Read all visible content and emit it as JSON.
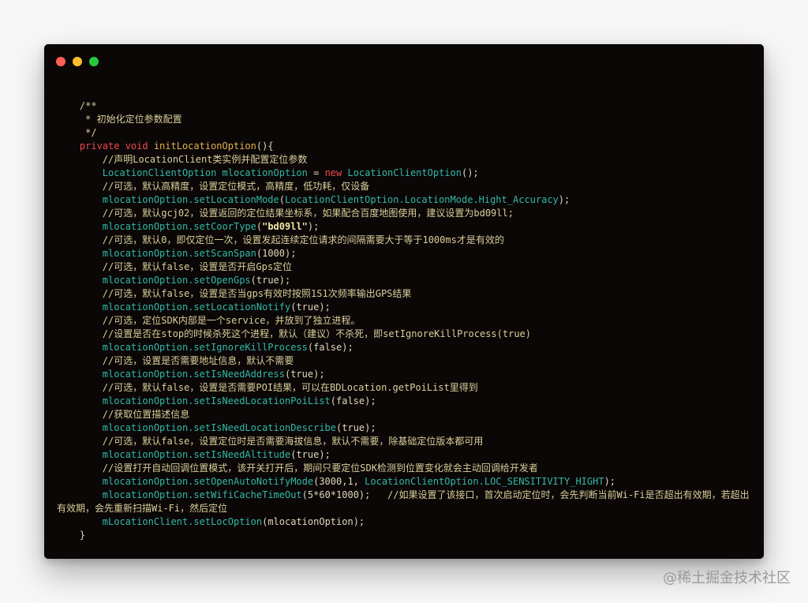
{
  "window": {
    "controls": {
      "close": "close",
      "minimize": "minimize",
      "zoom": "zoom"
    }
  },
  "code": {
    "lines": [
      {
        "segs": [
          {
            "t": "    "
          },
          {
            "c": "cm",
            "t": "/**"
          }
        ]
      },
      {
        "segs": [
          {
            "t": "     "
          },
          {
            "c": "cm",
            "t": "* 初始化定位参数配置"
          }
        ]
      },
      {
        "segs": [
          {
            "t": "     "
          },
          {
            "c": "cm",
            "t": "*/"
          }
        ]
      },
      {
        "segs": [
          {
            "t": "    "
          },
          {
            "c": "kw",
            "t": "private void "
          },
          {
            "c": "fn",
            "t": "initLocationOption"
          },
          {
            "c": "pn",
            "t": "(){"
          }
        ]
      },
      {
        "segs": [
          {
            "t": "        "
          },
          {
            "c": "cm",
            "t": "//声明LocationClient类实例并配置定位参数"
          }
        ]
      },
      {
        "segs": [
          {
            "t": "        "
          },
          {
            "c": "cls",
            "t": "LocationClientOption mlocationOption "
          },
          {
            "c": "pn",
            "t": "= "
          },
          {
            "c": "kw",
            "t": "new "
          },
          {
            "c": "cls",
            "t": "LocationClientOption"
          },
          {
            "c": "pn",
            "t": "();"
          }
        ]
      },
      {
        "segs": [
          {
            "t": "        "
          },
          {
            "c": "cm",
            "t": "//可选，默认高精度，设置定位模式，高精度，低功耗，仅设备"
          }
        ]
      },
      {
        "segs": [
          {
            "t": "        "
          },
          {
            "c": "cls",
            "t": "mlocationOption.setLocationMode"
          },
          {
            "c": "pn",
            "t": "("
          },
          {
            "c": "cls",
            "t": "LocationClientOption.LocationMode.Hight_Accuracy"
          },
          {
            "c": "pn",
            "t": ");"
          }
        ]
      },
      {
        "segs": [
          {
            "t": "        "
          },
          {
            "c": "cm",
            "t": "//可选，默认gcj02，设置返回的定位结果坐标系，如果配合百度地图使用，建议设置为bd09ll;"
          }
        ]
      },
      {
        "segs": [
          {
            "t": "        "
          },
          {
            "c": "cls",
            "t": "mlocationOption.setCoorType"
          },
          {
            "c": "pn",
            "t": "("
          },
          {
            "c": "str",
            "t": "\"bd09ll\""
          },
          {
            "c": "pn",
            "t": ");"
          }
        ]
      },
      {
        "segs": [
          {
            "t": "        "
          },
          {
            "c": "cm",
            "t": "//可选，默认0，即仅定位一次，设置发起连续定位请求的间隔需要大于等于1000ms才是有效的"
          }
        ]
      },
      {
        "segs": [
          {
            "t": "        "
          },
          {
            "c": "cls",
            "t": "mlocationOption.setScanSpan"
          },
          {
            "c": "pn",
            "t": "(1000);"
          }
        ]
      },
      {
        "segs": [
          {
            "t": "        "
          },
          {
            "c": "cm",
            "t": "//可选，默认false，设置是否开启Gps定位"
          }
        ]
      },
      {
        "segs": [
          {
            "t": "        "
          },
          {
            "c": "cls",
            "t": "mlocationOption.setOpenGps"
          },
          {
            "c": "pn",
            "t": "(true);"
          }
        ]
      },
      {
        "segs": [
          {
            "t": "        "
          },
          {
            "c": "cm",
            "t": "//可选，默认false，设置是否当gps有效时按照1S1次频率输出GPS结果"
          }
        ]
      },
      {
        "segs": [
          {
            "t": "        "
          },
          {
            "c": "cls",
            "t": "mlocationOption.setLocationNotify"
          },
          {
            "c": "pn",
            "t": "(true);"
          }
        ]
      },
      {
        "segs": [
          {
            "t": "        "
          },
          {
            "c": "cm",
            "t": "//可选，定位SDK内部是一个service，并放到了独立进程。"
          }
        ]
      },
      {
        "segs": [
          {
            "t": "        "
          },
          {
            "c": "cm",
            "t": "//设置是否在stop的时候杀死这个进程，默认（建议）不杀死，即setIgnoreKillProcess(true)"
          }
        ]
      },
      {
        "segs": [
          {
            "t": "        "
          },
          {
            "c": "cls",
            "t": "mlocationOption.setIgnoreKillProcess"
          },
          {
            "c": "pn",
            "t": "(false);"
          }
        ]
      },
      {
        "segs": [
          {
            "t": "        "
          },
          {
            "c": "cm",
            "t": "//可选，设置是否需要地址信息，默认不需要"
          }
        ]
      },
      {
        "segs": [
          {
            "t": "        "
          },
          {
            "c": "cls",
            "t": "mlocationOption.setIsNeedAddress"
          },
          {
            "c": "pn",
            "t": "(true);"
          }
        ]
      },
      {
        "segs": [
          {
            "t": "        "
          },
          {
            "c": "cm",
            "t": "//可选，默认false，设置是否需要POI结果，可以在BDLocation.getPoiList里得到"
          }
        ]
      },
      {
        "segs": [
          {
            "t": "        "
          },
          {
            "c": "cls",
            "t": "mlocationOption.setIsNeedLocationPoiList"
          },
          {
            "c": "pn",
            "t": "(false);"
          }
        ]
      },
      {
        "segs": [
          {
            "t": "        "
          },
          {
            "c": "cm",
            "t": "//获取位置描述信息"
          }
        ]
      },
      {
        "segs": [
          {
            "t": "        "
          },
          {
            "c": "cls",
            "t": "mlocationOption.setIsNeedLocationDescribe"
          },
          {
            "c": "pn",
            "t": "(true);"
          }
        ]
      },
      {
        "segs": [
          {
            "t": "        "
          },
          {
            "c": "cm",
            "t": "//可选，默认false，设置定位时是否需要海拔信息，默认不需要，除基础定位版本都可用"
          }
        ]
      },
      {
        "segs": [
          {
            "t": "        "
          },
          {
            "c": "cls",
            "t": "mlocationOption.setIsNeedAltitude"
          },
          {
            "c": "pn",
            "t": "(true);"
          }
        ]
      },
      {
        "segs": [
          {
            "t": "        "
          },
          {
            "c": "cm",
            "t": "//设置打开自动回调位置模式，该开关打开后，期间只要定位SDK检测到位置变化就会主动回调给开发者"
          }
        ]
      },
      {
        "segs": [
          {
            "t": "        "
          },
          {
            "c": "cls",
            "t": "mlocationOption.setOpenAutoNotifyMode"
          },
          {
            "c": "pn",
            "t": "(3000,1, "
          },
          {
            "c": "cls",
            "t": "LocationClientOption.LOC_SENSITIVITY_HIGHT"
          },
          {
            "c": "pn",
            "t": ");"
          }
        ]
      },
      {
        "wrap": true,
        "segs": [
          {
            "t": "        "
          },
          {
            "c": "cls",
            "t": "mlocationOption.setWifiCacheTimeOut"
          },
          {
            "c": "pn",
            "t": "(5*60*1000);   "
          },
          {
            "c": "cm",
            "t": "//如果设置了该接口，首次启动定位时，会先判断当前Wi-Fi是否超出有效期，若超出有效期，会先重新扫描Wi-Fi，然后定位"
          }
        ]
      },
      {
        "segs": [
          {
            "t": "        "
          },
          {
            "c": "cls",
            "t": "mLocationClient.setLocOption"
          },
          {
            "c": "pn",
            "t": "(mlocationOption);"
          }
        ]
      },
      {
        "segs": [
          {
            "t": "    "
          },
          {
            "c": "pn",
            "t": "}"
          }
        ]
      }
    ]
  },
  "watermark": "@稀土掘金技术社区"
}
